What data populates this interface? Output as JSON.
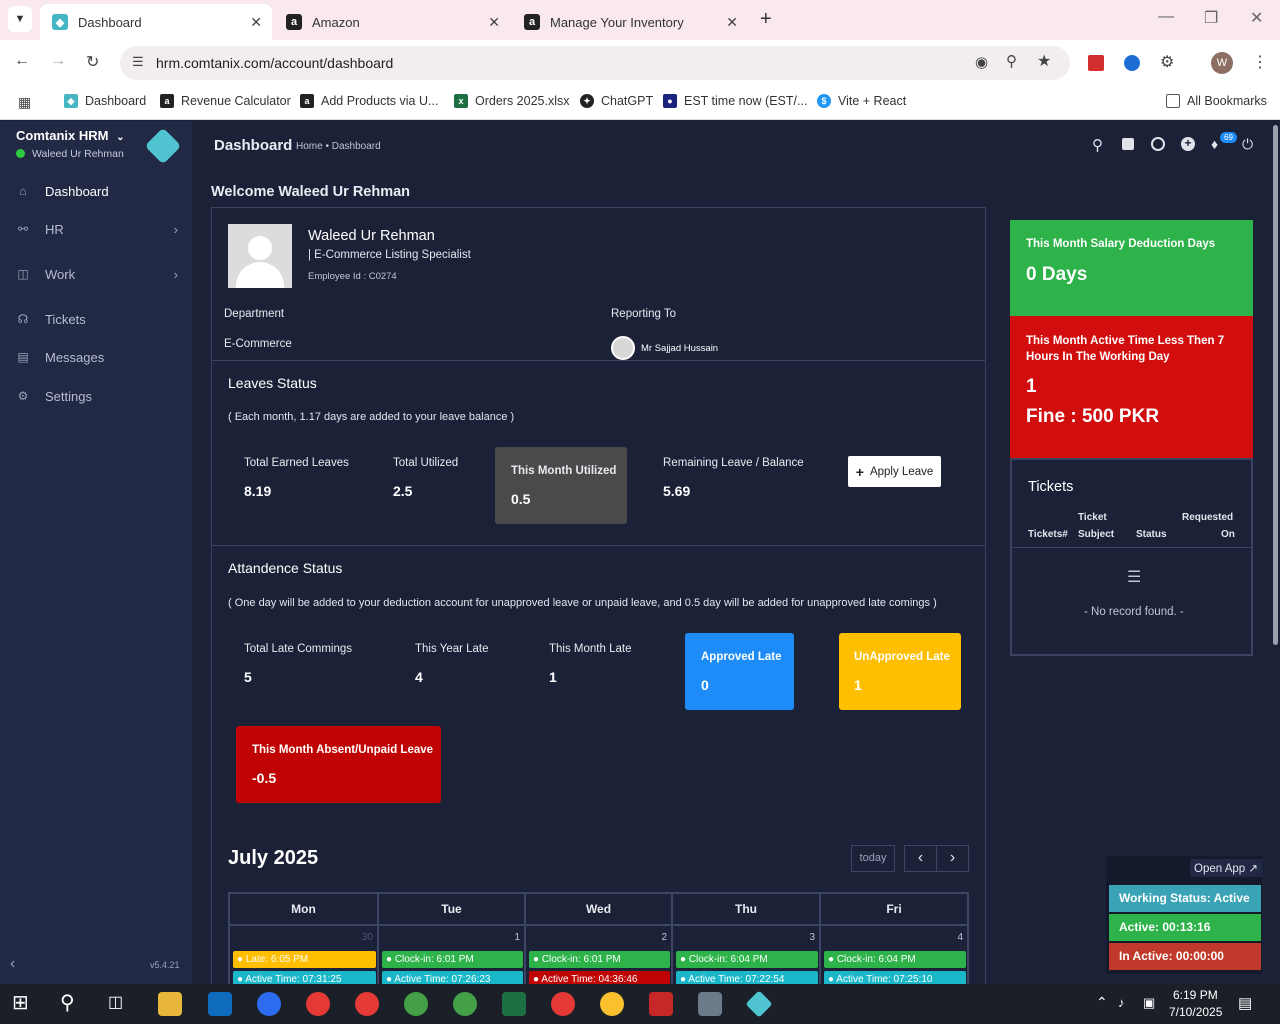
{
  "browser": {
    "tabs": [
      {
        "title": "Dashboard"
      },
      {
        "title": "Amazon"
      },
      {
        "title": "Manage Your Inventory"
      }
    ],
    "url": "hrm.comtanix.com/account/dashboard",
    "bookmarks": [
      {
        "label": "Dashboard"
      },
      {
        "label": "Revenue Calculator"
      },
      {
        "label": "Add Products via U..."
      },
      {
        "label": "Orders 2025.xlsx"
      },
      {
        "label": "ChatGPT"
      },
      {
        "label": "EST time now (EST/..."
      },
      {
        "label": "Vite + React"
      }
    ],
    "all_bookmarks": "All Bookmarks",
    "profile_initial": "W"
  },
  "sidebar": {
    "org": "Comtanix HRM",
    "user": "Waleed Ur Rehman",
    "items": [
      {
        "label": "Dashboard"
      },
      {
        "label": "HR"
      },
      {
        "label": "Work"
      },
      {
        "label": "Tickets"
      },
      {
        "label": "Messages"
      },
      {
        "label": "Settings"
      }
    ],
    "version": "v5.4.21"
  },
  "header": {
    "title": "Dashboard",
    "breadcrumb": "Home • Dashboard",
    "notif_count": "69"
  },
  "welcome": "Welcome Waleed Ur Rehman",
  "profile": {
    "name": "Waleed Ur Rehman",
    "role": "| E-Commerce Listing Specialist",
    "employee_id": "Employee Id : C0274",
    "dept_label": "Department",
    "dept_value": "E-Commerce",
    "reporting_label": "Reporting To",
    "reporting_value": "Mr Sajjad Hussain"
  },
  "leaves": {
    "title": "Leaves Status",
    "note": "( Each month, 1.17 days are added to your leave balance )",
    "earned_label": "Total Earned Leaves",
    "earned": "8.19",
    "utilized_label": "Total Utilized",
    "utilized": "2.5",
    "month_label": "This Month Utilized",
    "month": "0.5",
    "remaining_label": "Remaining Leave / Balance",
    "remaining": "5.69",
    "apply_button": "Apply Leave"
  },
  "attendance": {
    "title": "Attandence Status",
    "note": "( One day will be added to your deduction account for unapproved leave or unpaid leave, and 0.5 day will be added for unapproved late comings )",
    "late_total_label": "Total Late Commings",
    "late_total": "5",
    "year_late_label": "This Year Late",
    "year_late": "4",
    "month_late_label": "This Month Late",
    "month_late": "1",
    "approved_label": "Approved Late",
    "approved": "0",
    "unapproved_label": "UnApproved Late",
    "unapproved": "1",
    "absent_label": "This Month Absent/Unpaid Leave",
    "absent": "-0.5"
  },
  "right": {
    "salary_label": "This Month Salary Deduction Days",
    "salary_value": "0 Days",
    "active_label": "This Month Active Time Less Then 7 Hours In The Working Day",
    "active_value": "1",
    "fine": "Fine : 500 PKR",
    "tickets_title": "Tickets",
    "col1": "Tickets#",
    "col2a": "Ticket",
    "col2b": "Subject",
    "col3": "Status",
    "col4a": "Requested",
    "col4b": "On",
    "empty": "- No record found. -"
  },
  "calendar": {
    "title": "July 2025",
    "today": "today",
    "days": [
      "Mon",
      "Tue",
      "Wed",
      "Thu",
      "Fri"
    ],
    "dates": [
      "30",
      "1",
      "2",
      "3",
      "4"
    ],
    "events": [
      {
        "top": "Late: 6:05 PM",
        "bottom": "Active Time: 07:31:25"
      },
      {
        "top": "Clock-in: 6:01 PM",
        "bottom": "Active Time: 07:26:23"
      },
      {
        "top": "Clock-in: 6:01 PM",
        "bottom": "Active Time: 04:36:46"
      },
      {
        "top": "Clock-in: 6:04 PM",
        "bottom": "Active Time: 07:22:54"
      },
      {
        "top": "Clock-in: 6:04 PM",
        "bottom": "Active Time: 07:25:10"
      }
    ]
  },
  "floating": {
    "open_app": "Open App ↗",
    "working": "Working Status: Active",
    "active": "Active: 00:13:16",
    "inactive": "In Active: 00:00:00"
  },
  "taskbar": {
    "time": "6:19 PM",
    "date": "7/10/2025"
  },
  "colors": {
    "green": "#2db34a",
    "red": "#d10d0d",
    "blue": "#1d8cf8",
    "yellow": "#ffbf00",
    "dark_card": "#4a4a4a",
    "sidebar": "#222944",
    "main": "#1b2238"
  }
}
